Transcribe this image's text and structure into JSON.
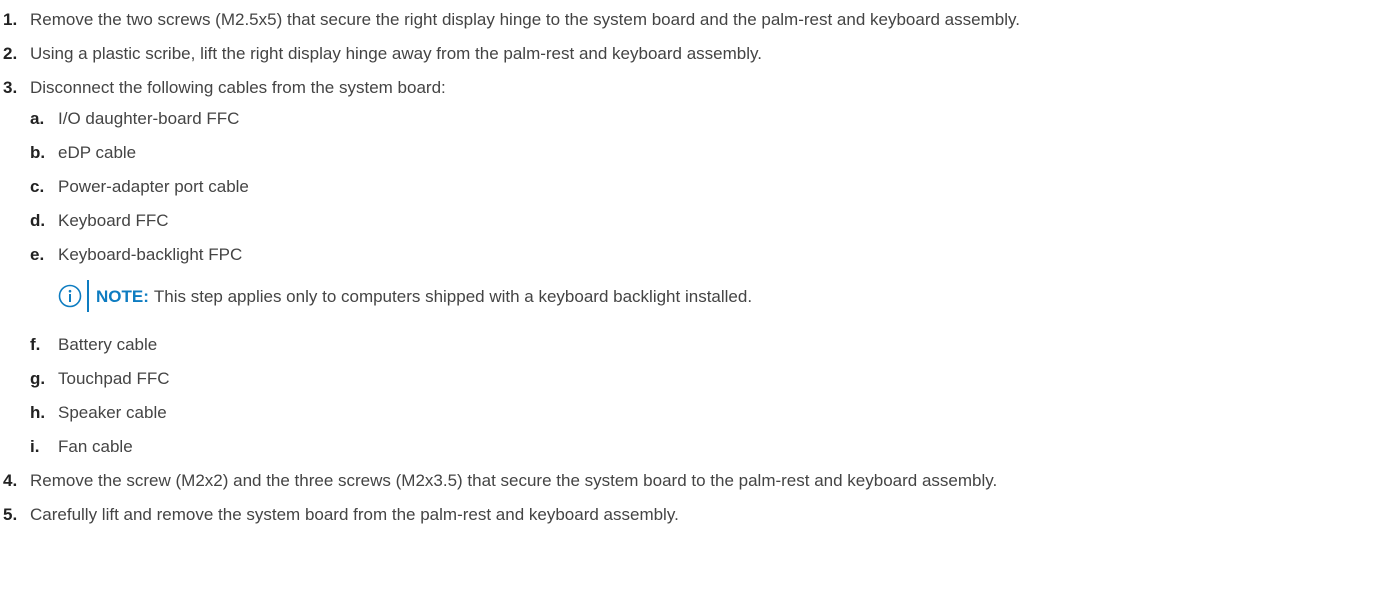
{
  "steps": [
    {
      "number": "1.",
      "text": "Remove the two screws (M2.5x5) that secure the right display hinge to the system board and the palm-rest and keyboard assembly."
    },
    {
      "number": "2.",
      "text": "Using a plastic scribe, lift the right display hinge away from the palm-rest and keyboard assembly."
    },
    {
      "number": "3.",
      "text": "Disconnect the following cables from the system board:",
      "subitems": [
        {
          "letter": "a.",
          "text": "I/O daughter-board FFC"
        },
        {
          "letter": "b.",
          "text": "eDP cable"
        },
        {
          "letter": "c.",
          "text": "Power-adapter port cable"
        },
        {
          "letter": "d.",
          "text": "Keyboard FFC"
        },
        {
          "letter": "e.",
          "text": "Keyboard-backlight FPC"
        },
        {
          "letter": "f.",
          "text": "Battery cable"
        },
        {
          "letter": "g.",
          "text": "Touchpad FFC"
        },
        {
          "letter": "h.",
          "text": "Speaker cable"
        },
        {
          "letter": "i.",
          "text": "Fan cable"
        }
      ],
      "note": {
        "icon": "info-icon",
        "label": "NOTE:",
        "text": "This step applies only to computers shipped with a keyboard backlight installed."
      }
    },
    {
      "number": "4.",
      "text": "Remove the screw (M2x2) and the three screws (M2x3.5) that secure the system board to the palm-rest and keyboard assembly."
    },
    {
      "number": "5.",
      "text": "Carefully lift and remove the system board from the palm-rest and keyboard assembly."
    }
  ],
  "colors": {
    "note_accent": "#0d7cc1",
    "body_text": "#444444",
    "number_text": "#222222"
  }
}
